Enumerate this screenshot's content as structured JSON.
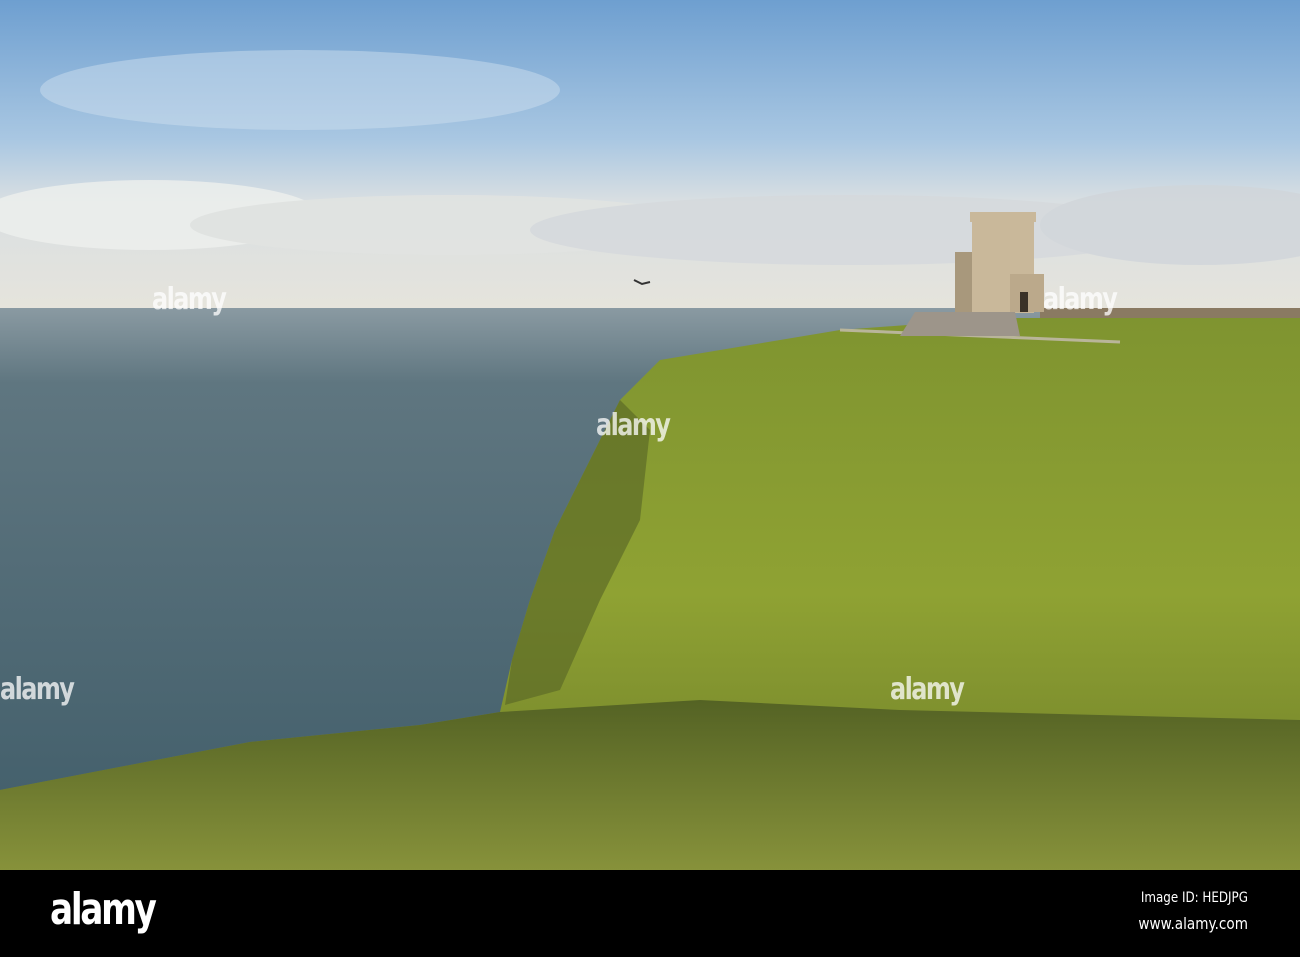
{
  "photo": {
    "subject": "O'Brien's Tower on the Cliffs of Moher",
    "colors": {
      "sky_top": "#6e9fd0",
      "sky_horizon": "#dfe3e3",
      "sea": "#4a6470",
      "grass": "#8a9a2c",
      "grass_shadow": "#4f5a1c",
      "tower": "#c9b89a"
    }
  },
  "watermark": {
    "text": "alamy"
  },
  "footer": {
    "logo": "alamy",
    "image_id": "Image ID: HEDJPG",
    "website": "www.alamy.com"
  }
}
